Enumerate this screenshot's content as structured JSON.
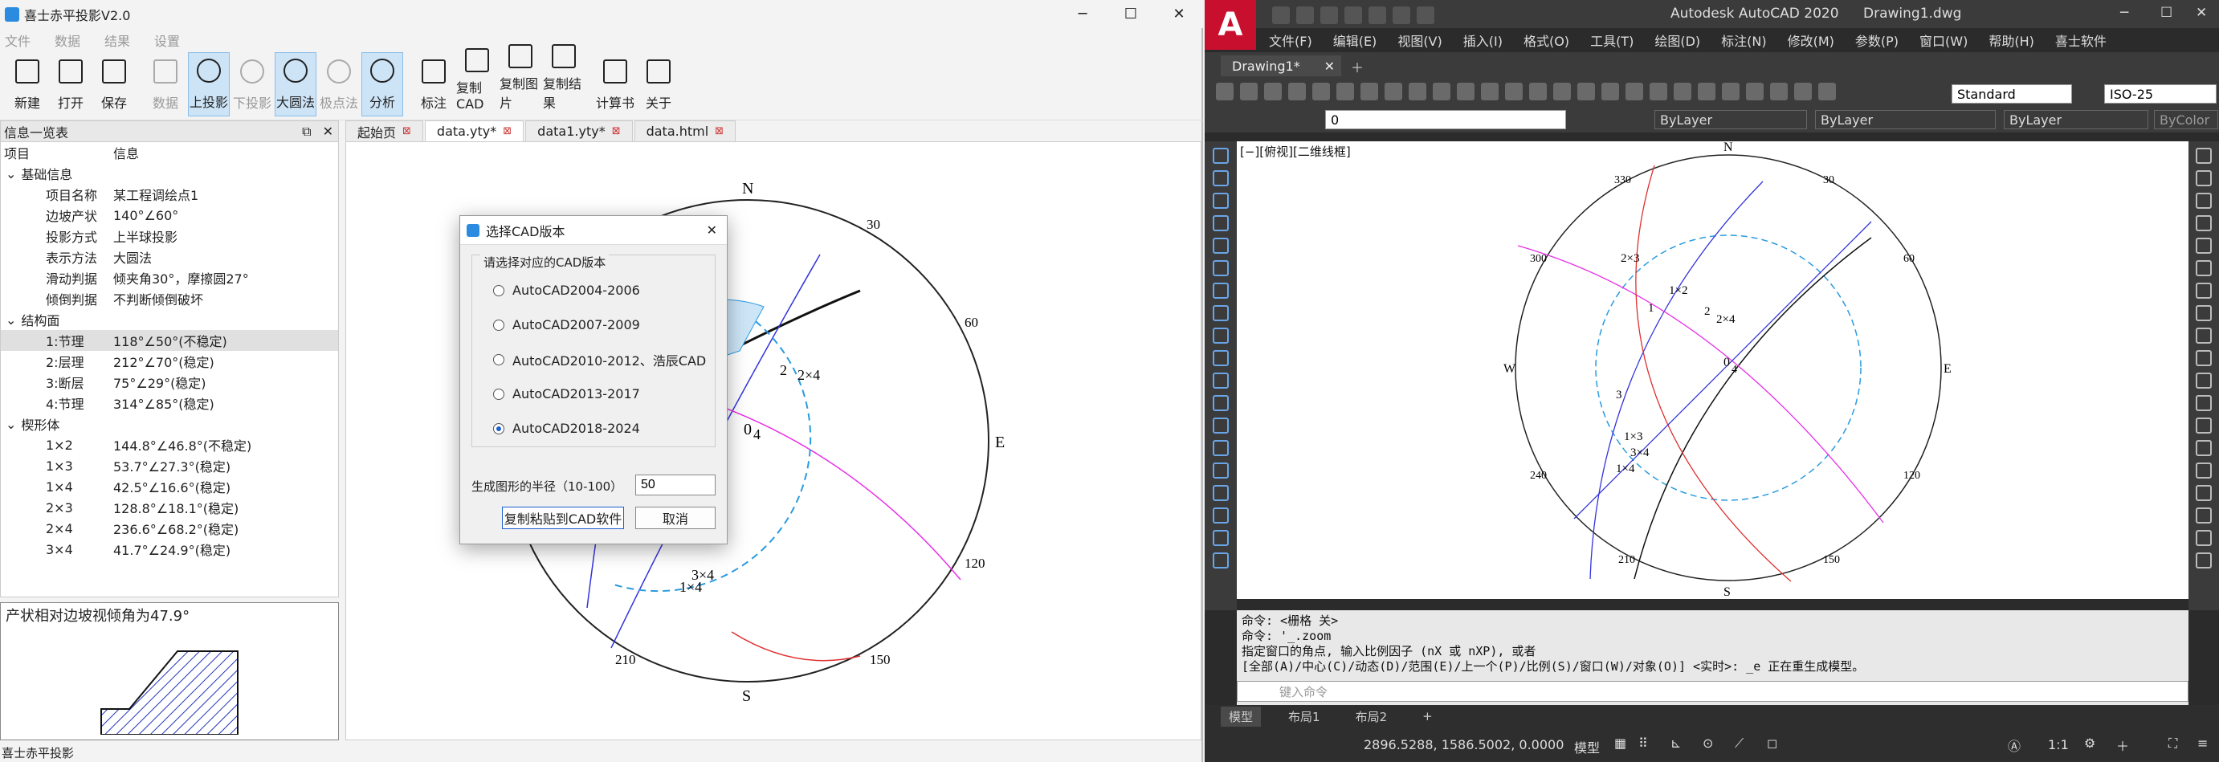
{
  "left_app": {
    "title": "喜士赤平投影V2.0",
    "menu": [
      "文件",
      "数据",
      "结果",
      "设置"
    ],
    "toolbar": [
      {
        "label": "新建",
        "icon": "new-file-icon",
        "state": "normal"
      },
      {
        "label": "打开",
        "icon": "folder-open-icon",
        "state": "normal"
      },
      {
        "label": "保存",
        "icon": "save-icon",
        "state": "normal"
      },
      {
        "label": "数据",
        "icon": "database-icon",
        "state": "disabled"
      },
      {
        "label": "上投影",
        "icon": "upper-hemisphere-icon",
        "state": "active"
      },
      {
        "label": "下投影",
        "icon": "lower-hemisphere-icon",
        "state": "disabled"
      },
      {
        "label": "大圆法",
        "icon": "great-circle-icon",
        "state": "active"
      },
      {
        "label": "极点法",
        "icon": "pole-method-icon",
        "state": "disabled"
      },
      {
        "label": "分析",
        "icon": "analyze-icon",
        "state": "active"
      },
      {
        "label": "标注",
        "icon": "bookmark-icon",
        "state": "normal"
      },
      {
        "label": "复制CAD",
        "icon": "cad-file-icon",
        "state": "normal"
      },
      {
        "label": "复制图片",
        "icon": "pic-file-icon",
        "state": "normal"
      },
      {
        "label": "复制结果",
        "icon": "txt-file-icon",
        "state": "normal"
      },
      {
        "label": "计算书",
        "icon": "clipboard-icon",
        "state": "normal"
      },
      {
        "label": "关于",
        "icon": "info-icon",
        "state": "normal"
      }
    ],
    "info_panel": {
      "title": "信息一览表",
      "col_item": "项目",
      "col_info": "信息",
      "groups": [
        {
          "name": "基础信息",
          "rows": [
            {
              "k": "项目名称",
              "v": "某工程调绘点1"
            },
            {
              "k": "边坡产状",
              "v": "140°∠60°"
            },
            {
              "k": "投影方式",
              "v": "上半球投影"
            },
            {
              "k": "表示方法",
              "v": "大圆法"
            },
            {
              "k": "滑动判据",
              "v": "倾夹角30°，摩擦圆27°"
            },
            {
              "k": "倾倒判据",
              "v": "不判断倾倒破坏"
            }
          ]
        },
        {
          "name": "结构面",
          "rows": [
            {
              "k": "1:节理",
              "v": "118°∠50°(不稳定)",
              "selected": true
            },
            {
              "k": "2:层理",
              "v": "212°∠70°(稳定)"
            },
            {
              "k": "3:断层",
              "v": "75°∠29°(稳定)"
            },
            {
              "k": "4:节理",
              "v": "314°∠85°(稳定)"
            }
          ]
        },
        {
          "name": "楔形体",
          "rows": [
            {
              "k": "1×2",
              "v": "144.8°∠46.8°(不稳定)"
            },
            {
              "k": "1×3",
              "v": "53.7°∠27.3°(稳定)"
            },
            {
              "k": "1×4",
              "v": "42.5°∠16.6°(稳定)"
            },
            {
              "k": "2×3",
              "v": "128.8°∠18.1°(稳定)"
            },
            {
              "k": "2×4",
              "v": "236.6°∠68.2°(稳定)"
            },
            {
              "k": "3×4",
              "v": "41.7°∠24.9°(稳定)"
            }
          ]
        }
      ]
    },
    "slope_note": "产状相对边坡视倾角为47.9°",
    "tabs": [
      {
        "label": "起始页",
        "active": false
      },
      {
        "label": "data.yty*",
        "active": true
      },
      {
        "label": "data1.yty*",
        "active": false
      },
      {
        "label": "data.html",
        "active": false
      }
    ],
    "compass": {
      "n": "N",
      "e": "E",
      "s": "S",
      "ticks": [
        "30",
        "60",
        "120",
        "150",
        "210"
      ]
    },
    "plot_labels": [
      "2",
      "2×4",
      "0",
      "4",
      "3×4",
      "1×4"
    ],
    "status": "喜士赤平投影",
    "dialog": {
      "title": "选择CAD版本",
      "group_label": "请选择对应的CAD版本",
      "options": [
        "AutoCAD2004-2006",
        "AutoCAD2007-2009",
        "AutoCAD2010-2012、浩辰CAD",
        "AutoCAD2013-2017",
        "AutoCAD2018-2024"
      ],
      "selected_index": 4,
      "radius_label": "生成图形的半径（10-100）",
      "radius_value": "50",
      "ok": "复制粘贴到CAD软件",
      "cancel": "取消"
    }
  },
  "right_app": {
    "title": "Autodesk AutoCAD 2020",
    "doc_title": "Drawing1.dwg",
    "menu": [
      "文件(F)",
      "编辑(E)",
      "视图(V)",
      "插入(I)",
      "格式(O)",
      "工具(T)",
      "绘图(D)",
      "标注(N)",
      "修改(M)",
      "参数(P)",
      "窗口(W)",
      "帮助(H)",
      "喜士软件"
    ],
    "doc_tab": "Drawing1*",
    "style_dd": "Standard",
    "dim_dd": "ISO-25",
    "layer_dd": "0",
    "color_dd": "ByLayer",
    "linetype_dd": "ByLayer",
    "lineweight_dd": "ByLayer",
    "plot_dd": "ByColor",
    "view_label": "[−][俯视][二维线框]",
    "compass": {
      "n": "N",
      "e": "E",
      "s": "S",
      "w": "W",
      "ticks": [
        "330",
        "30",
        "300",
        "60",
        "240",
        "120",
        "210",
        "150"
      ]
    },
    "plot_labels": [
      "2×3",
      "1×2",
      "1",
      "2",
      "2×4",
      "0",
      "4",
      "3",
      "1×3",
      "3×4",
      "1×4"
    ],
    "cmd_lines": [
      "命令:  <栅格 关>",
      "命令: '_.zoom",
      "指定窗口的角点, 输入比例因子 (nX 或 nXP), 或者",
      "[全部(A)/中心(C)/动态(D)/范围(E)/上一个(P)/比例(S)/窗口(W)/对象(O)] <实时>: _e 正在重生成模型。"
    ],
    "cmd_placeholder": "键入命令",
    "layout_tabs": [
      "模型",
      "布局1",
      "布局2"
    ],
    "coords": "2896.5288, 1586.5002, 0.0000",
    "model_label": "模型",
    "scale": "1:1"
  },
  "colors": {
    "accent": "#1a5fd0",
    "autocad_red": "#c8102e",
    "magenta": "#e830e8",
    "blue": "#3333dd",
    "red": "#e03030",
    "cyan_dash": "#2a9be0"
  }
}
